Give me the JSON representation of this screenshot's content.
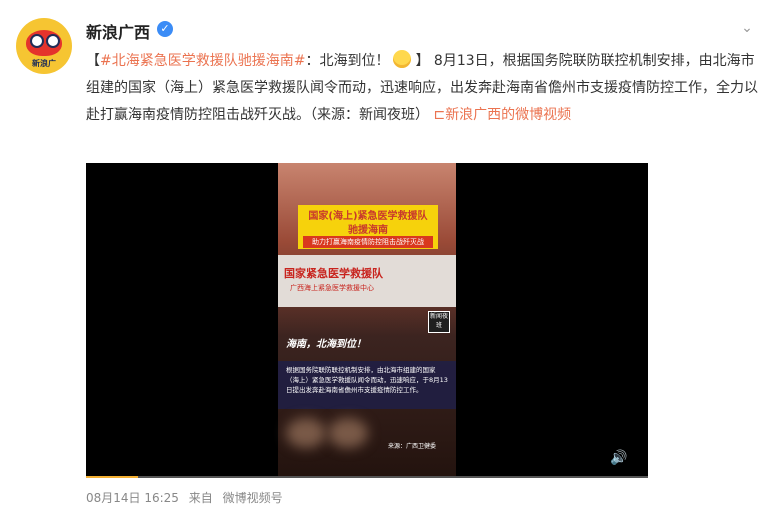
{
  "author": {
    "name": "新浪广西",
    "verified_icon": "verified-badge-icon",
    "avatar_text": "新浪广"
  },
  "more_icon": "chevron-down-icon",
  "post": {
    "bracket_open": "【",
    "topic": "#北海紧急医学救援队驰援海南#",
    "topic_suffix": "：北海到位！",
    "emoji": "cheer-emoji",
    "bracket_close": "】",
    "body": "8月13日，根据国务院联防联控机制安排，由北海市组建的国家（海上）紧急医学救援队闻令而动，迅速响应，出发奔赴海南省儋州市支援疫情防控工作，全力以赴打赢海南疫情防控阻击战歼灭战。（来源：新闻夜班）",
    "video_link": "新浪广西的微博视频"
  },
  "video": {
    "banner_line1": "国家(海上)紧急医学救援队",
    "banner_line2": "驰援海南",
    "banner_line3": "助力打赢海南疫情防控阻击战歼灭战",
    "truck_line1": "国家紧急医学救援队",
    "truck_line2": "广西海上紧急医学救援中心",
    "badge": "新闻夜班",
    "slogan": "海南，北海到位！",
    "caption": "根据国务院联防联控机制安排，由北海市组建的国家（海上）紧急医学救援队闻令而动，迅速响应，于8月13日提出发奔赴海南省儋州市支援疫情防控工作。",
    "source": "来源：广西卫健委",
    "volume_icon": "volume-icon",
    "progress": 0.093
  },
  "footer": {
    "time": "08月14日 16:25",
    "from": "来自",
    "client": "微博视频号"
  },
  "colors": {
    "link": "#eb7350",
    "verified": "#3b8cf6",
    "progress": "#f4b032"
  }
}
